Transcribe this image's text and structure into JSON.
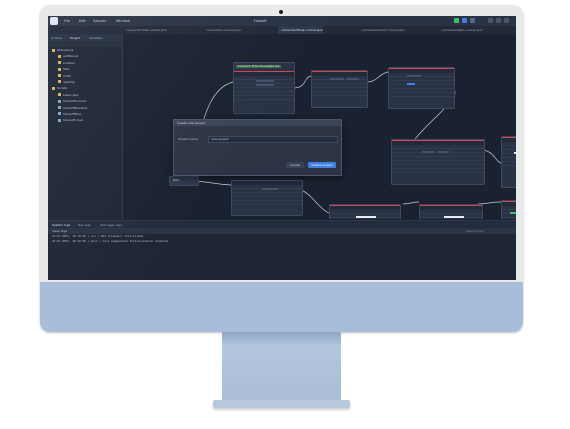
{
  "app": {
    "title": "Flowoff",
    "menu": [
      "File",
      "Edit",
      "Session",
      "Window"
    ],
    "file_tabs": [
      "connectionTest.current.json",
      "connection.current.json",
      "connectionFlow.current.json",
      "connectionClient.current.json",
      "connectionWeb.current.json"
    ]
  },
  "sidebar": {
    "panel_tabs": [
      "Actions",
      "Project",
      "Variables"
    ],
    "tree": [
      {
        "label": "Extensions",
        "type": "folder",
        "depth": 0
      },
      {
        "label": "additional",
        "type": "folder",
        "depth": 1
      },
      {
        "label": "browser",
        "type": "folder",
        "depth": 1
      },
      {
        "label": "files",
        "type": "folder",
        "depth": 1
      },
      {
        "label": "math",
        "type": "folder",
        "depth": 1
      },
      {
        "label": "desktop",
        "type": "folder",
        "depth": 1
      },
      {
        "label": "Scripts",
        "type": "folder",
        "depth": 0
      },
      {
        "label": "subscripts",
        "type": "folder",
        "depth": 1
      },
      {
        "label": "ShowoffCurrent",
        "type": "file",
        "depth": 1
      },
      {
        "label": "ShowoffDesktop",
        "type": "file",
        "depth": 1
      },
      {
        "label": "ShowoffFiles",
        "type": "file",
        "depth": 1
      },
      {
        "label": "Showoff.main",
        "type": "file",
        "depth": 1
      }
    ]
  },
  "canvas": {
    "start_label": "Start",
    "comment": "Comment: Enter the website link"
  },
  "dialog": {
    "title": "Create new project",
    "label": "Project name:",
    "value": "new project",
    "cancel": "Cancel",
    "create": "Create project"
  },
  "bottom": {
    "tabs": [
      "System logs",
      "Run logs",
      "Debugger logs"
    ],
    "filter_label": "Clear logs",
    "search_placeholder": "Search logs",
    "logs": [
      "10:21.0031, 10:19:38 | run | API (browser) Initialized",
      "10:21.0031, 10:19:38 | main | Core components Initialization complete"
    ]
  },
  "colors": {
    "screen_bg": "#1b2231",
    "accent_blue": "#3f7fe0",
    "node_red": "#d2474f",
    "run_green": "#3cc06a"
  }
}
